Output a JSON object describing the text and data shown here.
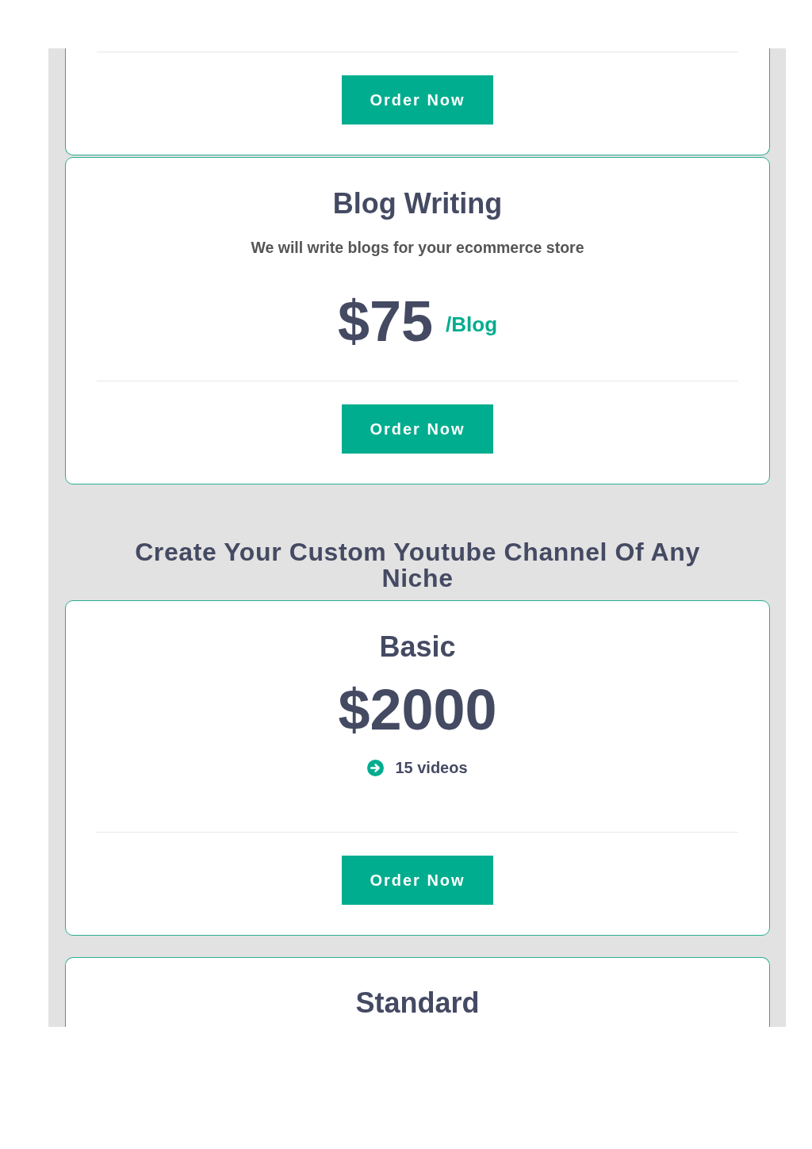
{
  "sections": [
    {
      "plans": [
        {
          "button": "Order Now"
        },
        {
          "title": "Blog Writing",
          "description": "We will write blogs for your ecommerce store",
          "price": "$75",
          "unit": "/Blog",
          "button": "Order Now"
        }
      ]
    },
    {
      "heading": "Create Your Custom Youtube Channel Of Any Niche",
      "plans": [
        {
          "title": "Basic",
          "price": "$2000",
          "features": [
            "15 videos"
          ],
          "button": "Order Now"
        },
        {
          "title": "Standard"
        }
      ]
    }
  ]
}
